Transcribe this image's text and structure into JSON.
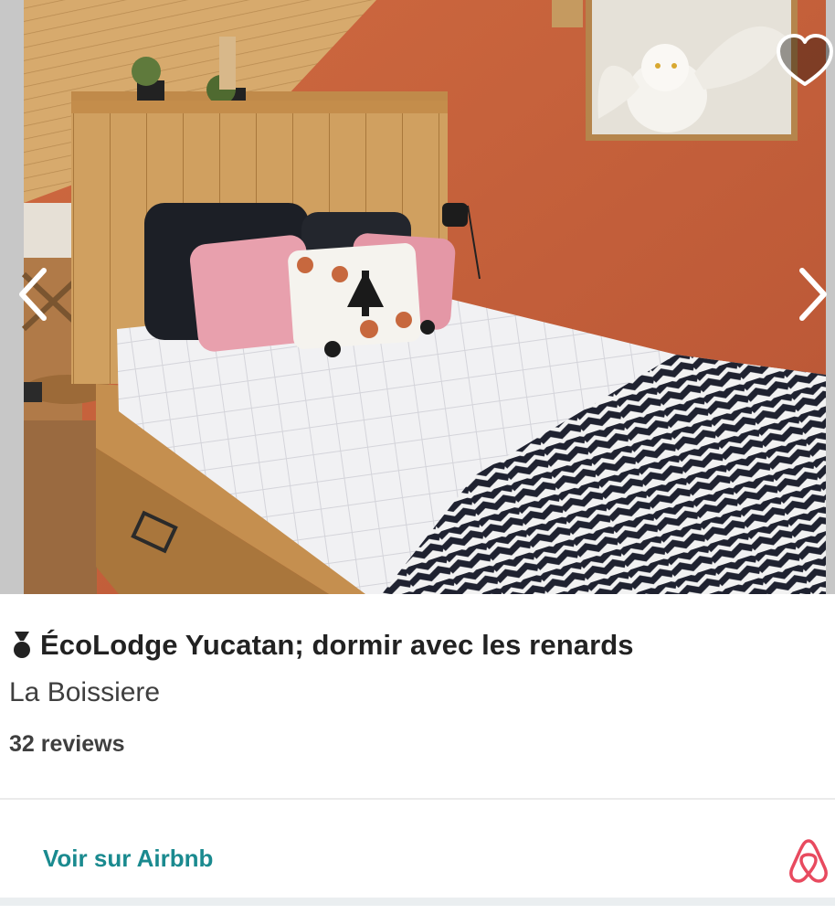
{
  "listing": {
    "title": "ÉcoLodge Yucatan; dormir avec les renards",
    "location": "La Boissiere",
    "reviews": "32 reviews"
  },
  "carousel": {
    "prev_icon": "chevron-left-icon",
    "next_icon": "chevron-right-icon",
    "wishlist_icon": "heart-icon"
  },
  "footer": {
    "cta_label": "Voir sur Airbnb",
    "brand_icon": "airbnb-logo-icon"
  },
  "colors": {
    "cta": "#1a8a8f",
    "logo": "#e84a5f",
    "wall": "#c8633d",
    "wood": "#c9944f"
  }
}
